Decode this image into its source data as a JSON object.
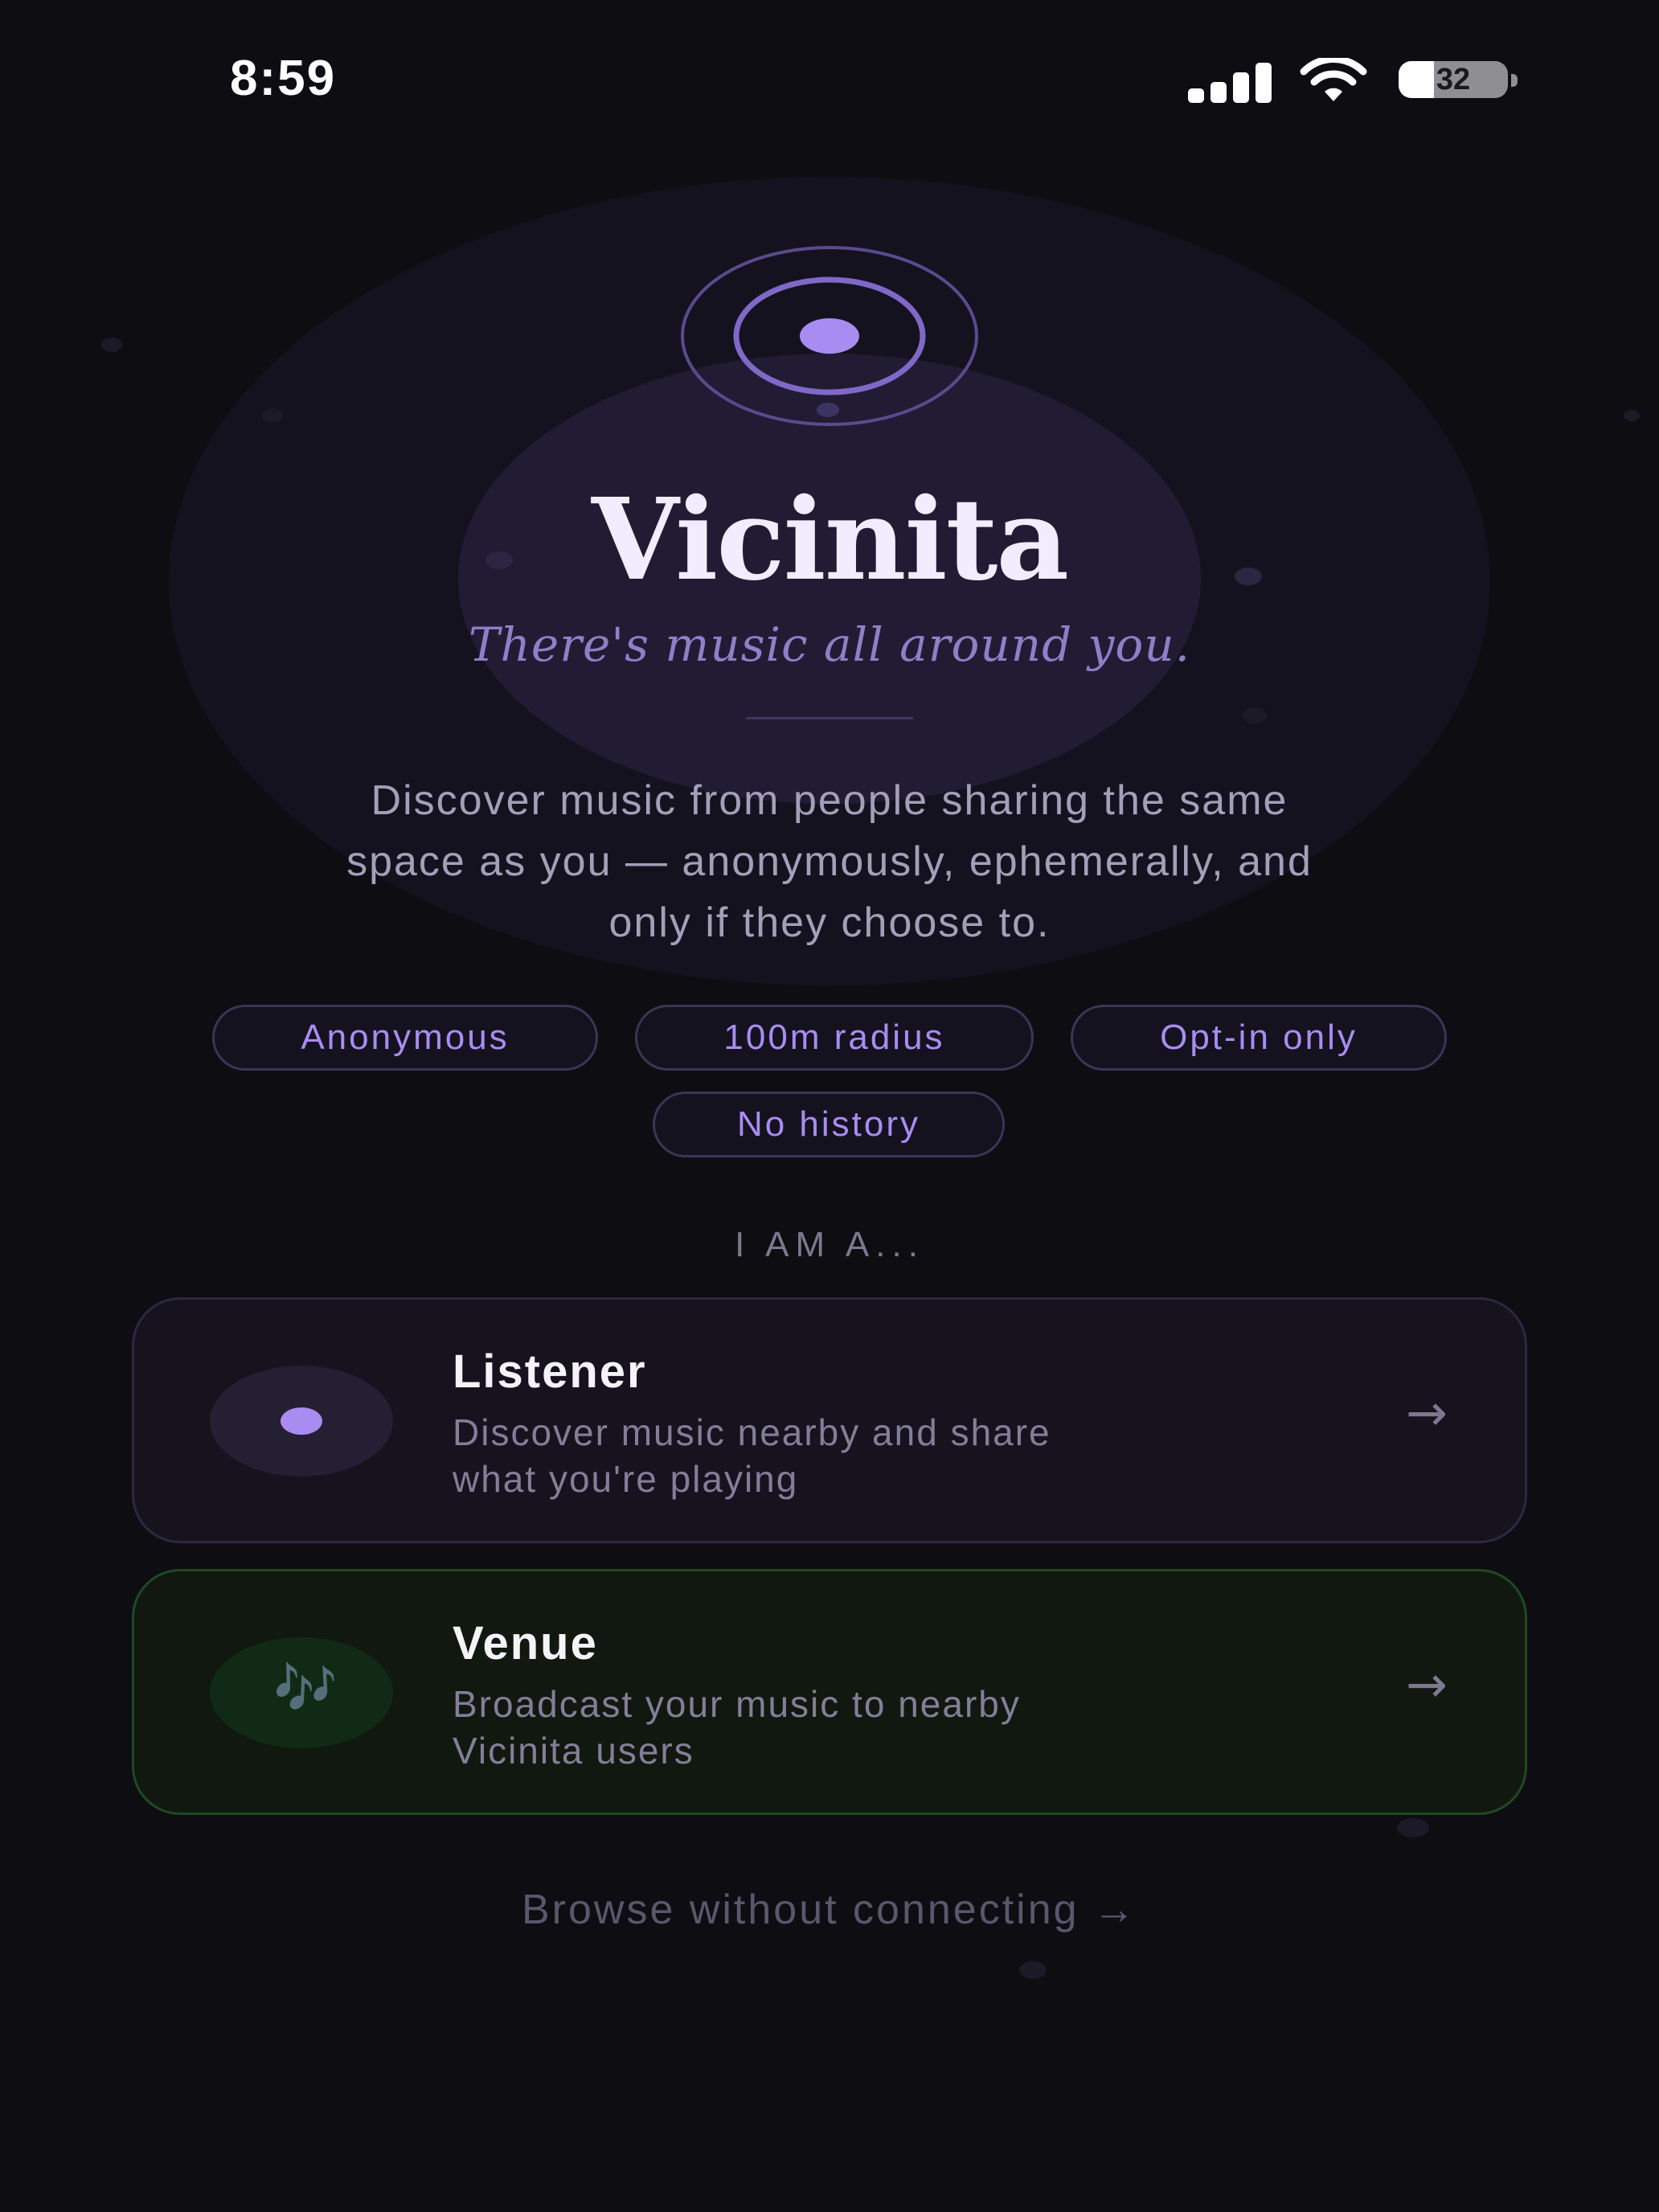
{
  "status_bar": {
    "time": "8:59",
    "battery": "32",
    "battery_level_fraction": 0.32
  },
  "hero": {
    "title": "Vicinita",
    "tagline": "There's music all around you.",
    "description_lines": [
      "Discover music from people sharing the same",
      "space as you — anonymously, ephemerally, and",
      "only if they choose to."
    ]
  },
  "features": [
    "Anonymous",
    "100m radius",
    "Opt-in only",
    "No history"
  ],
  "role_section": {
    "label": "I AM A...",
    "listener": {
      "title": "Listener",
      "description_lines": [
        "Discover music nearby and share",
        "what you're playing"
      ],
      "arrow": "→"
    },
    "venue": {
      "title": "Venue",
      "description_lines": [
        "Broadcast your music to nearby",
        "Vicinita users"
      ],
      "icon": "🎶",
      "arrow": "→"
    }
  },
  "browse_link": "Browse without connecting →",
  "colors": {
    "background": "#0e0d12",
    "accent_purple": "#a98cf2",
    "venue_green": "#1e4a24"
  }
}
